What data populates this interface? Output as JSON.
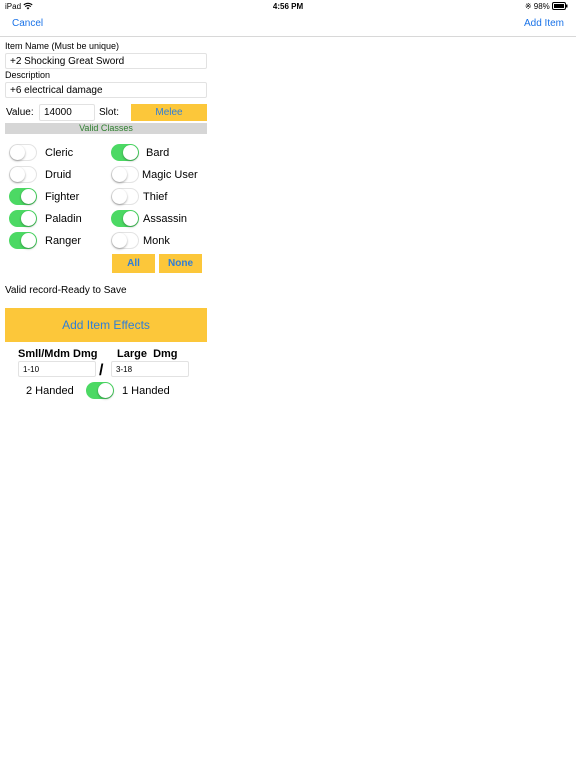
{
  "status": {
    "device": "iPad",
    "time": "4:56 PM",
    "battery": "98%"
  },
  "nav": {
    "cancel": "Cancel",
    "add_item": "Add Item"
  },
  "item_name": {
    "label": "Item Name (Must be unique)",
    "value": "+2 Shocking Great Sword"
  },
  "description": {
    "label": "Description",
    "value": "+6 electrical damage"
  },
  "value": {
    "label": "Value:",
    "value": "14000"
  },
  "slot": {
    "label": "Slot:",
    "value": "Melee"
  },
  "valid_classes": {
    "header": "Valid Classes",
    "left": [
      {
        "name": "Cleric",
        "on": false
      },
      {
        "name": "Druid",
        "on": false
      },
      {
        "name": "Fighter",
        "on": true
      },
      {
        "name": "Paladin",
        "on": true
      },
      {
        "name": "Ranger",
        "on": true
      }
    ],
    "right": [
      {
        "name": "Bard",
        "on": true
      },
      {
        "name": "Magic User",
        "on": false
      },
      {
        "name": "Thief",
        "on": false
      },
      {
        "name": "Assassin",
        "on": true
      },
      {
        "name": "Monk",
        "on": false
      }
    ],
    "all_label": "All",
    "none_label": "None"
  },
  "validation_message": "Valid record-Ready to Save",
  "add_effects_label": "Add Item Effects",
  "damage": {
    "small_label": "Smll/Mdm Dmg",
    "small_value": "1-10",
    "separator": "/",
    "large_label": "Large  Dmg",
    "large_value": "3-18"
  },
  "handed": {
    "two_label": "2 Handed",
    "one_label": "1 Handed",
    "one_handed_on": true
  },
  "colors": {
    "accent": "#1a73e8",
    "button": "#fcc73a",
    "toggle_on": "#4cd964"
  }
}
